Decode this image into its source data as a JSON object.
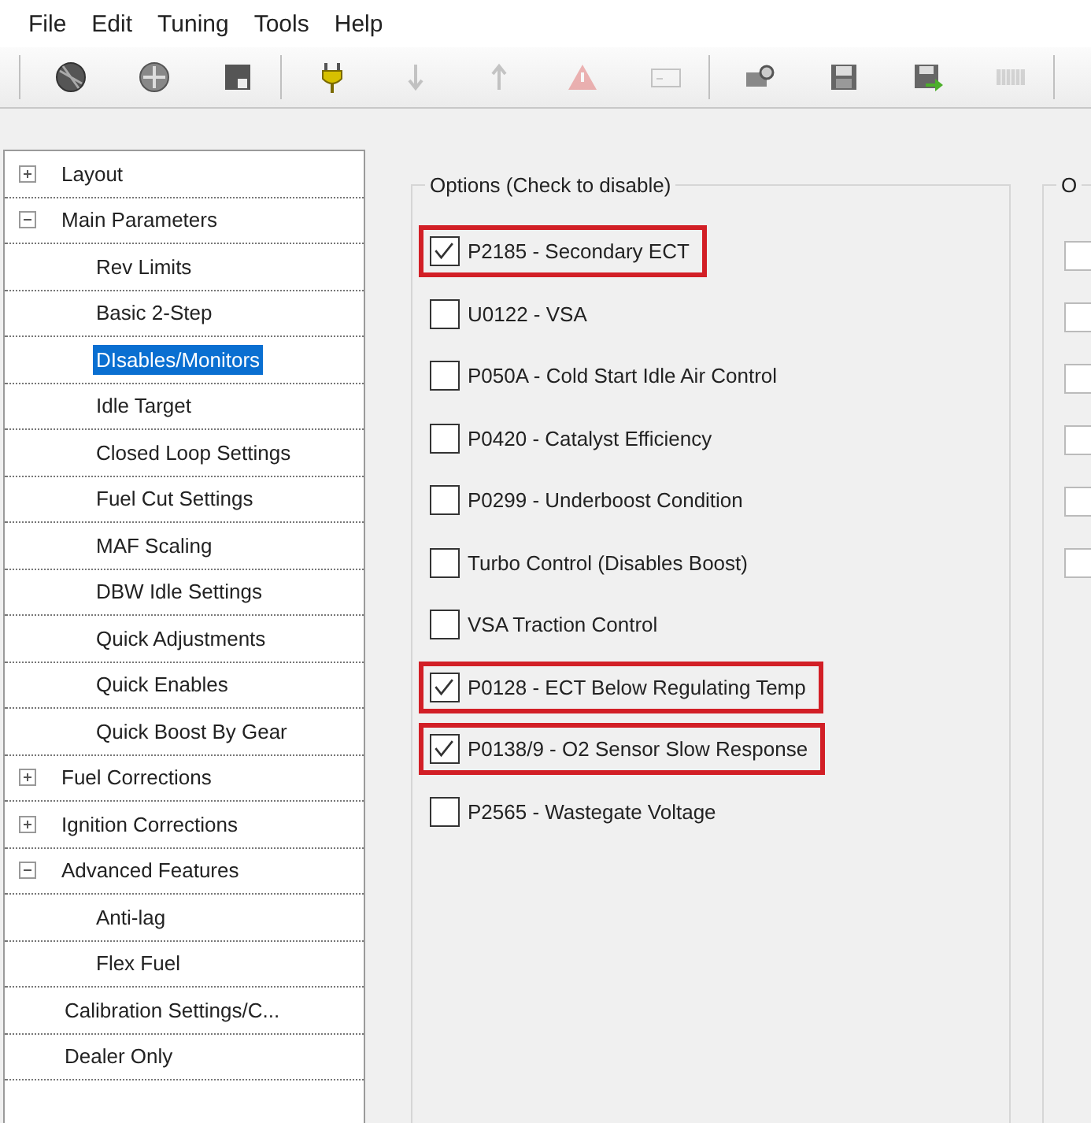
{
  "menu": [
    "File",
    "Edit",
    "Tuning",
    "Tools",
    "Help"
  ],
  "toolbar": [
    [
      {
        "disabled": false
      },
      {
        "disabled": false
      },
      {
        "disabled": false
      }
    ],
    [
      {
        "disabled": false
      },
      {
        "disabled": true
      },
      {
        "disabled": true
      },
      {
        "disabled": true
      },
      {
        "disabled": true
      }
    ],
    [
      {
        "disabled": false
      },
      {
        "disabled": false
      },
      {
        "disabled": false
      },
      {
        "disabled": true
      }
    ]
  ],
  "tree": [
    {
      "label": "Layout",
      "expanded": false,
      "selected": false
    },
    {
      "label": "Main Parameters",
      "expanded": true,
      "selected": false,
      "children": [
        {
          "label": "Rev Limits",
          "selected": false
        },
        {
          "label": "Basic 2-Step",
          "selected": false
        },
        {
          "label": "DIsables/Monitors",
          "selected": true
        },
        {
          "label": "Idle Target",
          "selected": false
        },
        {
          "label": "Closed Loop Settings",
          "selected": false
        },
        {
          "label": "Fuel Cut Settings",
          "selected": false
        },
        {
          "label": "MAF Scaling",
          "selected": false
        },
        {
          "label": "DBW Idle Settings",
          "selected": false
        },
        {
          "label": "Quick Adjustments",
          "selected": false
        },
        {
          "label": "Quick Enables",
          "selected": false
        },
        {
          "label": "Quick Boost By Gear",
          "selected": false
        }
      ]
    },
    {
      "label": "Fuel Corrections",
      "expanded": false,
      "selected": false
    },
    {
      "label": "Ignition Corrections",
      "expanded": false,
      "selected": false
    },
    {
      "label": "Advanced Features",
      "expanded": true,
      "selected": false,
      "children": [
        {
          "label": "Anti-lag",
          "selected": false
        },
        {
          "label": "Flex Fuel",
          "selected": false
        }
      ]
    },
    {
      "label": "Calibration Settings/C...",
      "selected": false
    },
    {
      "label": "Dealer Only",
      "selected": false
    }
  ],
  "options_group": {
    "title": "Options (Check to disable)",
    "options": [
      {
        "label": "P2185 - Secondary ECT",
        "checked": true,
        "highlighted": true
      },
      {
        "label": "U0122 - VSA",
        "checked": false,
        "highlighted": false
      },
      {
        "label": "P050A - Cold Start Idle Air Control",
        "checked": false,
        "highlighted": false
      },
      {
        "label": "P0420 - Catalyst Efficiency",
        "checked": false,
        "highlighted": false
      },
      {
        "label": "P0299 - Underboost Condition",
        "checked": false,
        "highlighted": false
      },
      {
        "label": "Turbo Control (Disables Boost)",
        "checked": false,
        "highlighted": false
      },
      {
        "label": "VSA Traction Control",
        "checked": false,
        "highlighted": false
      },
      {
        "label": "P0128 - ECT Below Regulating Temp",
        "checked": true,
        "highlighted": true
      },
      {
        "label": "P0138/9 - O2 Sensor Slow Response",
        "checked": true,
        "highlighted": true
      },
      {
        "label": "P2565 - Wastegate Voltage",
        "checked": false,
        "highlighted": false
      }
    ]
  },
  "second_group": {
    "title": "O",
    "checkboxes": [
      {
        "checked": false
      },
      {
        "checked": false
      },
      {
        "checked": false
      },
      {
        "checked": false
      },
      {
        "checked": false
      },
      {
        "checked": false
      }
    ]
  }
}
